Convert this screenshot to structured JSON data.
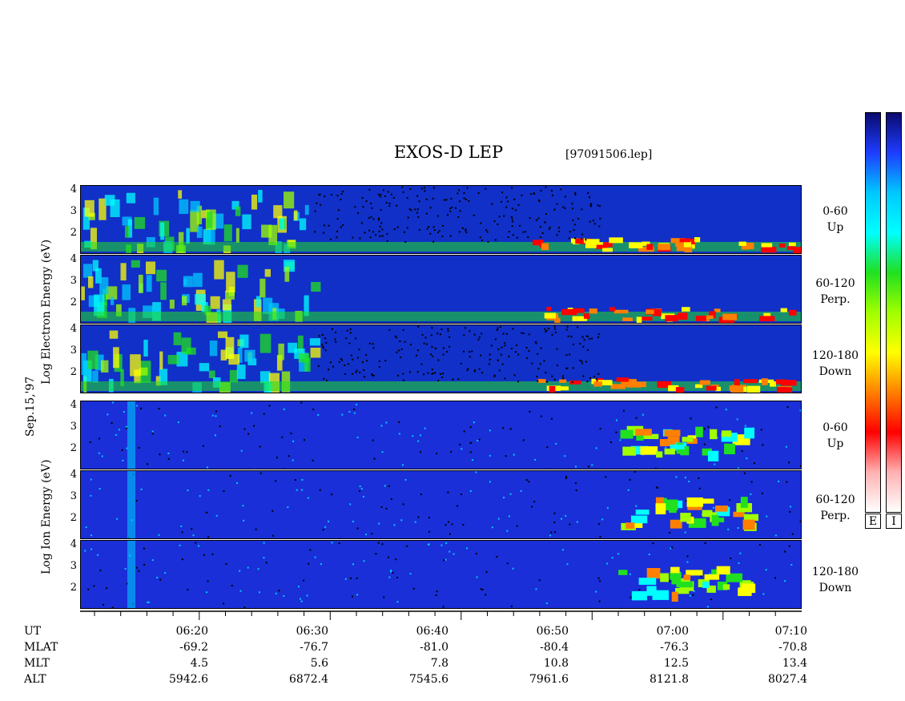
{
  "header": {
    "title": "EXOS-D LEP",
    "file": "[97091506.lep]"
  },
  "side_label": "Sep.15,'97",
  "electron_axis_label": "Log  Electron  Energy (eV)",
  "ion_axis_label": "Log  Ion  Energy (eV)",
  "colorbar": {
    "labels": [
      "E",
      "I"
    ],
    "colors": [
      "#0a0a6e",
      "#1e3cff",
      "#00c8ff",
      "#00ffff",
      "#20e020",
      "#a0ff00",
      "#ffff00",
      "#ff8000",
      "#ff0000",
      "#ffb0b0",
      "#ffffff"
    ]
  },
  "footer": {
    "row_labels": [
      "UT",
      "MLAT",
      "MLT",
      "ALT"
    ],
    "columns": [
      {
        "ut": "06:20",
        "mlat": "-69.2",
        "mlt": "4.5",
        "alt": "5942.6"
      },
      {
        "ut": "06:30",
        "mlat": "-76.7",
        "mlt": "5.6",
        "alt": "6872.4"
      },
      {
        "ut": "06:40",
        "mlat": "-81.0",
        "mlt": "7.8",
        "alt": "7545.6"
      },
      {
        "ut": "06:50",
        "mlat": "-80.4",
        "mlt": "10.8",
        "alt": "7961.6"
      },
      {
        "ut": "07:00",
        "mlat": "-76.3",
        "mlt": "12.5",
        "alt": "8121.8"
      },
      {
        "ut": "07:10",
        "mlat": "-70.8",
        "mlt": "13.4",
        "alt": "8027.4"
      }
    ]
  },
  "chart_data": {
    "type": "heatmap",
    "title": "EXOS-D LEP",
    "x_unit": "UT",
    "x_ticks": [
      "06:20",
      "06:30",
      "06:40",
      "06:50",
      "07:00",
      "07:10"
    ],
    "y_ticks": [
      "1",
      "2",
      "3",
      "4"
    ],
    "panels": [
      {
        "species": "Electron",
        "pitch": "0-60",
        "dir": "Up"
      },
      {
        "species": "Electron",
        "pitch": "60-120",
        "dir": "Perp."
      },
      {
        "species": "Electron",
        "pitch": "120-180",
        "dir": "Down"
      },
      {
        "species": "Ion",
        "pitch": "0-60",
        "dir": "Up"
      },
      {
        "species": "Ion",
        "pitch": "60-120",
        "dir": "Perp."
      },
      {
        "species": "Ion",
        "pitch": "120-180",
        "dir": "Down"
      }
    ]
  }
}
